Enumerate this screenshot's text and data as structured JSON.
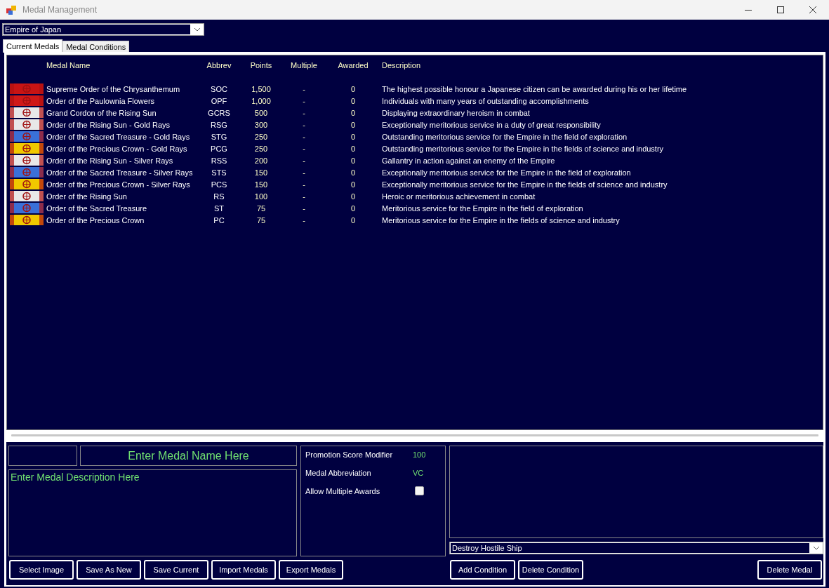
{
  "window": {
    "title": "Medal Management"
  },
  "race_select": {
    "value": "Empire of Japan"
  },
  "tabs": [
    {
      "label": "Current Medals",
      "selected": true
    },
    {
      "label": "Medal Conditions",
      "selected": false
    }
  ],
  "table": {
    "columns": [
      "Medal Name",
      "Abbrev",
      "Points",
      "Multiple",
      "Awarded",
      "Description"
    ],
    "rows": [
      {
        "color": "#c81414",
        "name": "Supreme Order of the Chrysanthemum",
        "abbrev": "SOC",
        "points": "1,500",
        "multiple": "-",
        "awarded": "0",
        "description": "The highest possible honour a Japanese citizen can be awarded during his or her lifetime"
      },
      {
        "color": "#d01818",
        "name": "Order of the Paulownia Flowers",
        "abbrev": "OPF",
        "points": "1,000",
        "multiple": "-",
        "awarded": "0",
        "description": "Individuals with many years of outstanding accomplishments"
      },
      {
        "color": "#e8e8e8",
        "name": "Grand Cordon of the Rising Sun",
        "abbrev": "GCRS",
        "points": "500",
        "multiple": "-",
        "awarded": "0",
        "description": "Displaying extraordinary heroism in combat"
      },
      {
        "color": "#e8e8e8",
        "name": "Order of the Rising Sun - Gold Rays",
        "abbrev": "RSG",
        "points": "300",
        "multiple": "-",
        "awarded": "0",
        "description": "Exceptionally meritorious service in a duty of great responsibility"
      },
      {
        "color": "#3a70d8",
        "name": "Order of the Sacred Treasure - Gold Rays",
        "abbrev": "STG",
        "points": "250",
        "multiple": "-",
        "awarded": "0",
        "description": "Outstanding meritorious service for the Empire in the field of exploration"
      },
      {
        "color": "#f0c800",
        "name": "Order of the Precious Crown - Gold Rays",
        "abbrev": "PCG",
        "points": "250",
        "multiple": "-",
        "awarded": "0",
        "description": "Outstanding meritorious service for the Empire in the fields of science and industry"
      },
      {
        "color": "#e8e8e8",
        "name": "Order of the Rising Sun - Silver Rays",
        "abbrev": "RSS",
        "points": "200",
        "multiple": "-",
        "awarded": "0",
        "description": "Gallantry in action against an enemy of the Empire"
      },
      {
        "color": "#3a70d8",
        "name": "Order of the Sacred Treasure - Silver Rays",
        "abbrev": "STS",
        "points": "150",
        "multiple": "-",
        "awarded": "0",
        "description": "Exceptionally meritorious service for the Empire in the field of exploration"
      },
      {
        "color": "#f0c800",
        "name": "Order of the Precious Crown - Silver Rays",
        "abbrev": "PCS",
        "points": "150",
        "multiple": "-",
        "awarded": "0",
        "description": "Exceptionally meritorious service for the Empire in the fields of science and industry"
      },
      {
        "color": "#e8e8e8",
        "name": "Order of the Rising Sun",
        "abbrev": "RS",
        "points": "100",
        "multiple": "-",
        "awarded": "0",
        "description": "Heroic or meritorious achievement in combat"
      },
      {
        "color": "#3a70d8",
        "name": "Order of the Sacred Treasure",
        "abbrev": "ST",
        "points": "75",
        "multiple": "-",
        "awarded": "0",
        "description": "Meritorious service for the Empire in the field of exploration"
      },
      {
        "color": "#f0c800",
        "name": "Order of the Precious Crown",
        "abbrev": "PC",
        "points": "75",
        "multiple": "-",
        "awarded": "0",
        "description": "Meritorious service for the Empire in the fields of science and industry"
      }
    ]
  },
  "editor": {
    "name_value": "Enter Medal Name Here",
    "description_value": "Enter Medal Description Here",
    "properties": [
      {
        "kind": "value",
        "label": "Promotion Score Modifier",
        "value": "100"
      },
      {
        "kind": "value",
        "label": "Medal Abbreviation",
        "value": "VC"
      },
      {
        "kind": "checkbox",
        "label": "Allow Multiple Awards",
        "checked": false
      }
    ],
    "condition_select": {
      "value": "Destroy Hostile Ship"
    },
    "buttons_left": [
      "Select Image",
      "Save As New",
      "Save Current",
      "Import Medals",
      "Export Medals"
    ],
    "buttons_conditions": [
      "Add Condition",
      "Delete Condition"
    ],
    "button_delete": "Delete Medal"
  }
}
